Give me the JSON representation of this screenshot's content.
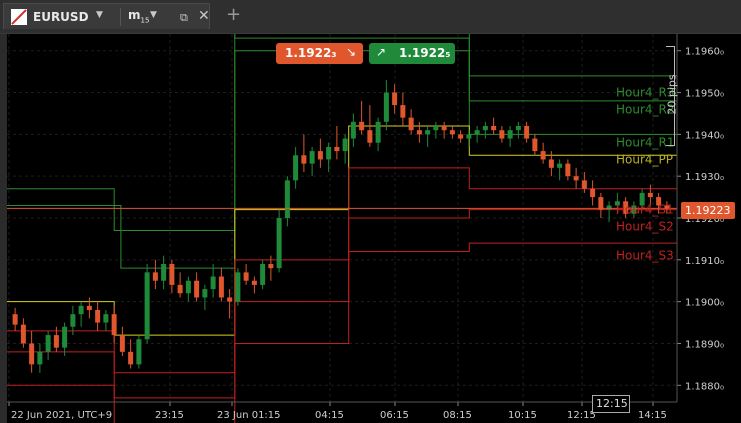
{
  "tab": {
    "symbol": "EURUSD",
    "timeframe": "m",
    "timeframe_sub": "15",
    "dropdown": "▼",
    "popout": "⧉",
    "close": "✕",
    "add": "+"
  },
  "quotes": {
    "sell": "1.1922₃",
    "buy": "1.1922₅"
  },
  "current_price": "1.19223",
  "pips_label": "20 pips",
  "colors": {
    "sell": "#e0562d",
    "buy": "#1f8a3a",
    "price_line": "#e0562d"
  },
  "chart_data": {
    "type": "candlestick",
    "ylim": [
      1.1876,
      1.1964
    ],
    "y_ticks": [
      "1.1960₀",
      "1.1950₀",
      "1.1940₀",
      "1.1930₀",
      "1.1920₀",
      "1.1910₀",
      "1.1900₀",
      "1.1890₀",
      "1.1880₀"
    ],
    "x_ticks": [
      "22 Jun 2021, UTC+9",
      "23:15",
      "23 Jun 01:15",
      "04:15",
      "06:15",
      "08:15",
      "10:15",
      "12:15",
      "14:15"
    ],
    "crosshair_time": "12:15",
    "pivot_labels": [
      {
        "name": "Hour4_R3",
        "value": 1.195,
        "color": "#2e8b2e"
      },
      {
        "name": "Hour4_R2",
        "value": 1.1946,
        "color": "#2e8b2e"
      },
      {
        "name": "Hour4_R1",
        "value": 1.1938,
        "color": "#2e8b2e"
      },
      {
        "name": "Hour4_PP",
        "value": 1.1934,
        "color": "#b8b020"
      },
      {
        "name": "Hour4_S1",
        "value": 1.1922,
        "color": "#c02020"
      },
      {
        "name": "Hour4_S2",
        "value": 1.1918,
        "color": "#c02020"
      },
      {
        "name": "Hour4_S3",
        "value": 1.1911,
        "color": "#c02020"
      }
    ],
    "pivot_series": [
      {
        "name": "R3",
        "color": "#2e8b2e",
        "segments": [
          [
            0,
            0.03,
            1.1989
          ],
          [
            0.03,
            0.34,
            1.1989
          ],
          [
            0.34,
            0.69,
            1.1963
          ],
          [
            0.69,
            1,
            1.1954
          ]
        ]
      },
      {
        "name": "R2",
        "color": "#2e8b2e",
        "segments": [
          [
            0,
            0.16,
            1.1927
          ],
          [
            0.16,
            0.34,
            1.1917
          ],
          [
            0.34,
            0.69,
            1.1966
          ],
          [
            0.69,
            1,
            1.1948
          ]
        ]
      },
      {
        "name": "R1",
        "color": "#2e8b2e",
        "segments": [
          [
            0,
            0.17,
            1.1923
          ],
          [
            0.17,
            0.34,
            1.1908
          ],
          [
            0.34,
            0.69,
            1.196
          ],
          [
            0.69,
            1,
            1.194
          ]
        ]
      },
      {
        "name": "PP",
        "color": "#d8d020",
        "segments": [
          [
            0,
            0.16,
            1.19
          ],
          [
            0.16,
            0.34,
            1.1892
          ],
          [
            0.34,
            0.51,
            1.1922
          ],
          [
            0.51,
            0.69,
            1.1942
          ],
          [
            0.69,
            1,
            1.1935
          ]
        ]
      },
      {
        "name": "S1",
        "color": "#c02020",
        "segments": [
          [
            0,
            0.16,
            1.1893
          ],
          [
            0.16,
            0.34,
            1.1883
          ],
          [
            0.34,
            0.51,
            1.191
          ],
          [
            0.51,
            0.69,
            1.1932
          ],
          [
            0.69,
            1,
            1.1927
          ]
        ]
      },
      {
        "name": "S2",
        "color": "#c02020",
        "segments": [
          [
            0,
            0.16,
            1.1888
          ],
          [
            0.16,
            0.34,
            1.1877
          ],
          [
            0.34,
            0.51,
            1.19
          ],
          [
            0.51,
            0.69,
            1.192
          ],
          [
            0.69,
            1,
            1.1922
          ]
        ]
      },
      {
        "name": "S3",
        "color": "#c02020",
        "segments": [
          [
            0,
            0.16,
            1.188
          ],
          [
            0.16,
            0.34,
            1.1868
          ],
          [
            0.34,
            0.51,
            1.189
          ],
          [
            0.51,
            0.69,
            1.1912
          ],
          [
            0.69,
            1,
            1.1914
          ]
        ]
      }
    ],
    "candles": [
      [
        1.1897,
        1.18985,
        1.1893,
        1.18945
      ],
      [
        1.18945,
        1.1896,
        1.1889,
        1.189
      ],
      [
        1.189,
        1.1893,
        1.1883,
        1.1885
      ],
      [
        1.1885,
        1.189,
        1.1883,
        1.1888
      ],
      [
        1.1888,
        1.1893,
        1.1886,
        1.1892
      ],
      [
        1.1892,
        1.1894,
        1.1888,
        1.1889
      ],
      [
        1.1889,
        1.1895,
        1.1887,
        1.1894
      ],
      [
        1.1894,
        1.1899,
        1.1892,
        1.1897
      ],
      [
        1.1897,
        1.19,
        1.1894,
        1.1899
      ],
      [
        1.1899,
        1.1901,
        1.1896,
        1.1898
      ],
      [
        1.1898,
        1.19,
        1.1893,
        1.1895
      ],
      [
        1.1895,
        1.1898,
        1.1893,
        1.1897
      ],
      [
        1.1897,
        1.1899,
        1.189,
        1.1892
      ],
      [
        1.1892,
        1.1894,
        1.1887,
        1.1888
      ],
      [
        1.1888,
        1.1891,
        1.1884,
        1.1885
      ],
      [
        1.1885,
        1.1892,
        1.1884,
        1.1891
      ],
      [
        1.1891,
        1.1909,
        1.189,
        1.1907
      ],
      [
        1.1907,
        1.191,
        1.1903,
        1.1905
      ],
      [
        1.1905,
        1.1911,
        1.1903,
        1.1909
      ],
      [
        1.1909,
        1.191,
        1.1902,
        1.1904
      ],
      [
        1.1904,
        1.1907,
        1.1901,
        1.1902
      ],
      [
        1.1902,
        1.1906,
        1.19,
        1.1905
      ],
      [
        1.1905,
        1.1907,
        1.19,
        1.1901
      ],
      [
        1.1901,
        1.1904,
        1.1898,
        1.1903
      ],
      [
        1.1903,
        1.1909,
        1.1901,
        1.1906
      ],
      [
        1.1906,
        1.1908,
        1.19,
        1.1901
      ],
      [
        1.1901,
        1.1903,
        1.1896,
        1.19
      ],
      [
        1.19,
        1.1908,
        1.1899,
        1.1907
      ],
      [
        1.1907,
        1.1909,
        1.1904,
        1.1905
      ],
      [
        1.1905,
        1.1906,
        1.1902,
        1.1904
      ],
      [
        1.1904,
        1.191,
        1.1903,
        1.1909
      ],
      [
        1.1909,
        1.1911,
        1.1905,
        1.1908
      ],
      [
        1.1908,
        1.1922,
        1.1907,
        1.192
      ],
      [
        1.192,
        1.193,
        1.1918,
        1.1929
      ],
      [
        1.1929,
        1.1937,
        1.1927,
        1.1935
      ],
      [
        1.1935,
        1.194,
        1.1931,
        1.1933
      ],
      [
        1.1933,
        1.1937,
        1.193,
        1.1936
      ],
      [
        1.1936,
        1.1939,
        1.1932,
        1.1934
      ],
      [
        1.1934,
        1.1938,
        1.1931,
        1.1937
      ],
      [
        1.1937,
        1.1942,
        1.1934,
        1.1936
      ],
      [
        1.1936,
        1.194,
        1.1933,
        1.1939
      ],
      [
        1.1939,
        1.1945,
        1.1937,
        1.1943
      ],
      [
        1.1943,
        1.1948,
        1.194,
        1.1941
      ],
      [
        1.1941,
        1.1947,
        1.1937,
        1.1938
      ],
      [
        1.1938,
        1.1944,
        1.1936,
        1.1943
      ],
      [
        1.1943,
        1.1953,
        1.1941,
        1.195
      ],
      [
        1.195,
        1.1952,
        1.1945,
        1.1947
      ],
      [
        1.1947,
        1.195,
        1.1942,
        1.1944
      ],
      [
        1.1944,
        1.1946,
        1.194,
        1.1941
      ],
      [
        1.1941,
        1.1943,
        1.1938,
        1.194
      ],
      [
        1.194,
        1.1942,
        1.1937,
        1.1941
      ],
      [
        1.1941,
        1.1943,
        1.1939,
        1.1942
      ],
      [
        1.1942,
        1.1943,
        1.1939,
        1.1941
      ],
      [
        1.1941,
        1.1942,
        1.1939,
        1.194
      ],
      [
        1.194,
        1.1941,
        1.1938,
        1.1939
      ],
      [
        1.1939,
        1.1941,
        1.1937,
        1.194
      ],
      [
        1.194,
        1.1942,
        1.1938,
        1.1941
      ],
      [
        1.1941,
        1.1943,
        1.1939,
        1.1942
      ],
      [
        1.1942,
        1.1944,
        1.194,
        1.1941
      ],
      [
        1.1941,
        1.1942,
        1.1938,
        1.1939
      ],
      [
        1.1939,
        1.1942,
        1.1937,
        1.1941
      ],
      [
        1.1941,
        1.1943,
        1.1939,
        1.1942
      ],
      [
        1.1942,
        1.1943,
        1.1938,
        1.1939
      ],
      [
        1.1939,
        1.194,
        1.1935,
        1.1936
      ],
      [
        1.1936,
        1.1938,
        1.1933,
        1.1934
      ],
      [
        1.1934,
        1.1936,
        1.193,
        1.1932
      ],
      [
        1.1932,
        1.1934,
        1.1929,
        1.1933
      ],
      [
        1.1933,
        1.1934,
        1.1929,
        1.193
      ],
      [
        1.193,
        1.1932,
        1.1927,
        1.1929
      ],
      [
        1.1929,
        1.1931,
        1.1926,
        1.1927
      ],
      [
        1.1927,
        1.1929,
        1.1923,
        1.1925
      ],
      [
        1.1925,
        1.1926,
        1.192,
        1.1922
      ],
      [
        1.1922,
        1.1924,
        1.1919,
        1.1923
      ],
      [
        1.1923,
        1.1926,
        1.1921,
        1.1924
      ],
      [
        1.1924,
        1.1925,
        1.192,
        1.1921
      ],
      [
        1.1921,
        1.1924,
        1.192,
        1.1923
      ],
      [
        1.1923,
        1.1927,
        1.1922,
        1.1926
      ],
      [
        1.1926,
        1.1928,
        1.1923,
        1.1925
      ],
      [
        1.1925,
        1.1926,
        1.1921,
        1.1923
      ],
      [
        1.1923,
        1.1924,
        1.1921,
        1.19223
      ]
    ]
  }
}
